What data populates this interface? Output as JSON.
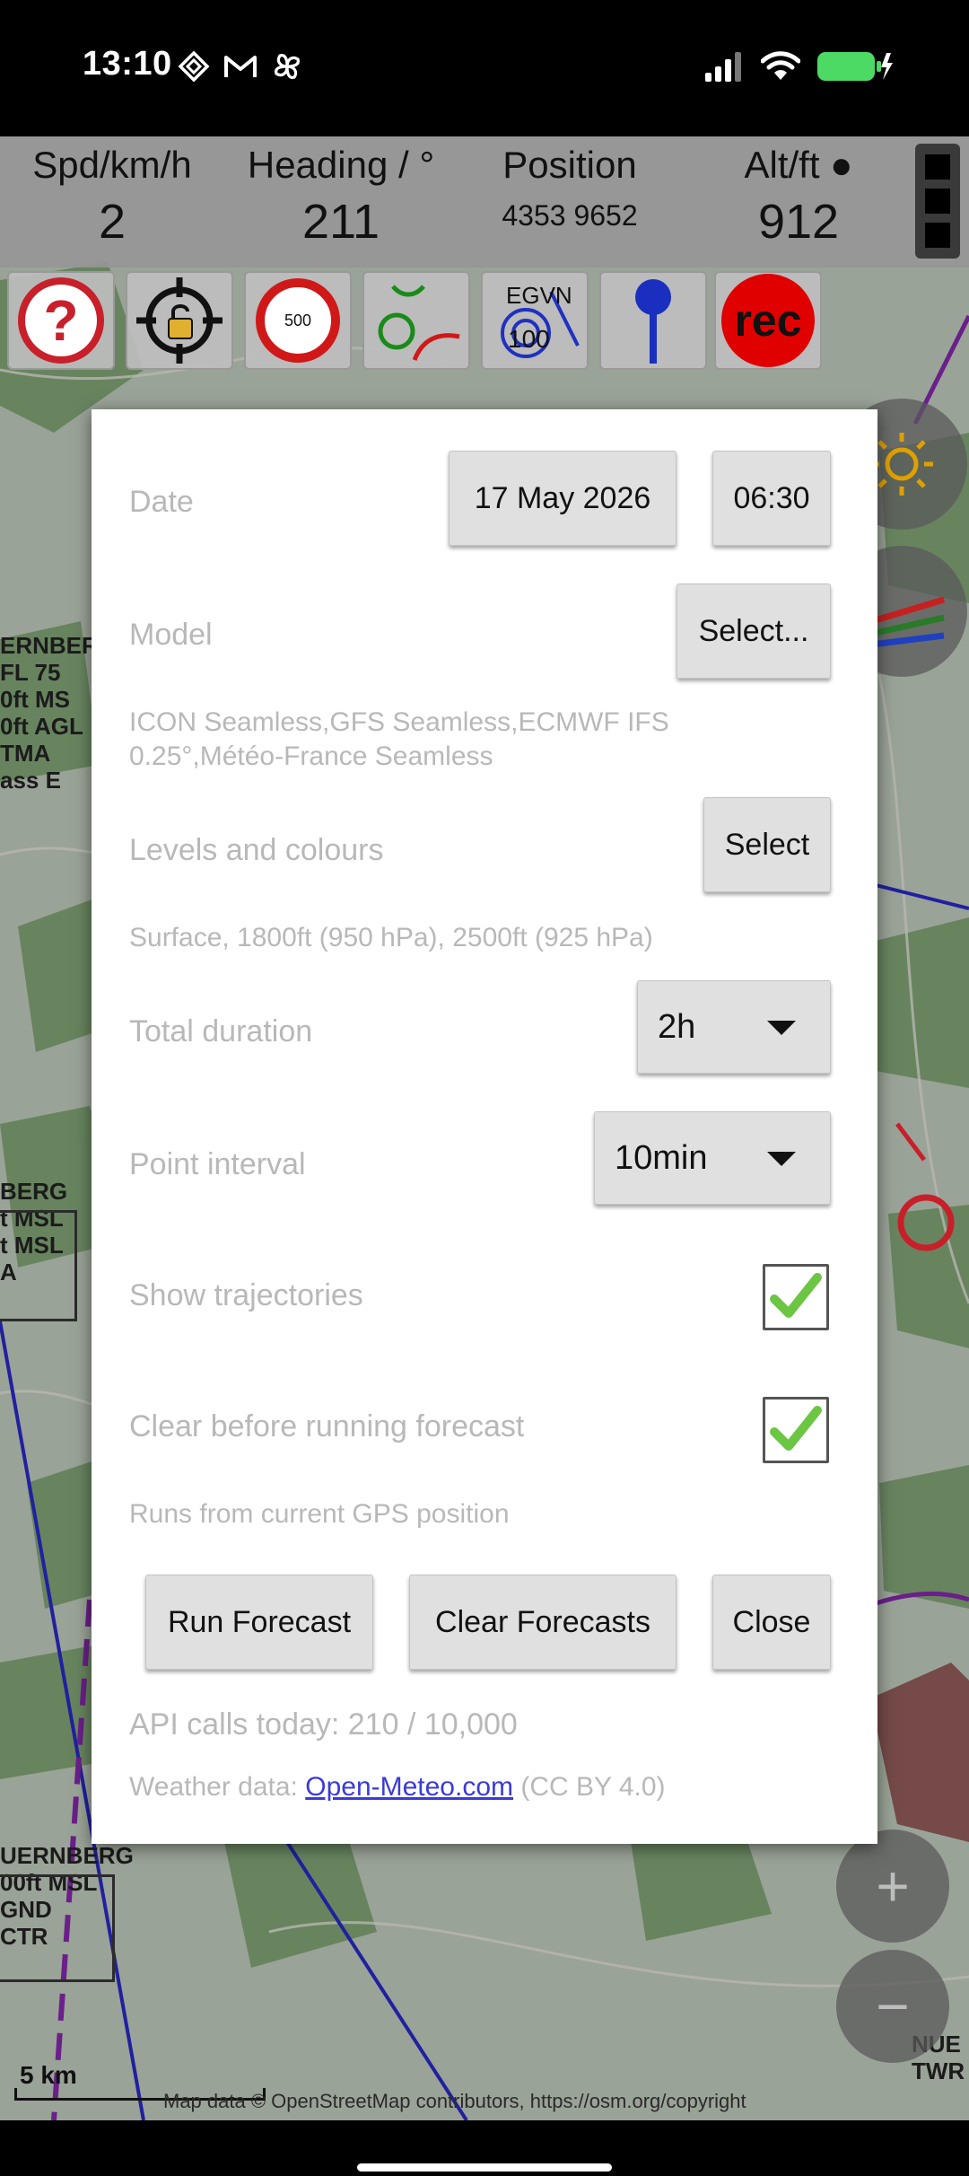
{
  "status_bar": {
    "time": "13:10",
    "left_icons": [
      "diamond-icon",
      "gmail-icon",
      "pinwheel-icon"
    ],
    "right_icons": [
      "signal-icon",
      "wifi-icon",
      "battery-charging-icon"
    ],
    "battery_color": "#4cd964"
  },
  "instruments": {
    "speed": {
      "label": "Spd/km/h",
      "value": "2"
    },
    "heading": {
      "label": "Heading / °",
      "value": "211"
    },
    "position": {
      "label": "Position",
      "value": "4353 9652"
    },
    "altitude": {
      "label": "Alt/ft ●",
      "value": "912"
    }
  },
  "toolbar": {
    "tools": [
      "help-icon",
      "lock-target-icon",
      "altitude-500-icon",
      "route-icon",
      "airport-egvn-icon",
      "pin-icon",
      "record-icon"
    ],
    "altitude_badge": "500",
    "airport_badge_top": "EGVN",
    "airport_badge_bottom": "100",
    "record_label": "rec"
  },
  "map": {
    "labels": {
      "nuernberg_top": "ERNBER\nFL 75\n0ft MS\n0ft AGL\nTMA\nass E",
      "nuernberg_mid": "BERG\nt MSL\nt MSL\nA",
      "nuernberg_bottom": "UERNBERG\n00ft MSL\nGND\nCTR",
      "nue_twr": "NUE\nTWR"
    },
    "scale": "5 km",
    "attribution": "Map data © OpenStreetMap contributors, https://osm.org/copyright",
    "zoom_in": "+",
    "zoom_out": "−"
  },
  "dialog": {
    "date_label": "Date",
    "date_value": "17 May 2026",
    "time_value": "06:30",
    "model_label": "Model",
    "model_button": "Select...",
    "model_summary_line1": "ICON Seamless,GFS Seamless,ECMWF IFS",
    "model_summary_line2": "0.25°,Météo-France Seamless",
    "levels_label": "Levels and colours",
    "levels_button": "Select",
    "levels_summary": "Surface, 1800ft (950 hPa), 2500ft (925 hPa)",
    "duration_label": "Total duration",
    "duration_value": "2h",
    "interval_label": "Point interval",
    "interval_value": "10min",
    "trajectories_label": "Show trajectories",
    "trajectories_checked": true,
    "clear_label": "Clear before running forecast",
    "clear_checked": true,
    "runs_from": "Runs from current GPS position",
    "run_button": "Run Forecast",
    "clear_button": "Clear Forecasts",
    "close_button": "Close",
    "api_calls": "API calls today: 210 / 10,000",
    "weather_prefix": "Weather data: ",
    "weather_link": "Open-Meteo.com",
    "weather_suffix": " (CC BY 4.0)",
    "check_color": "#6cc644"
  }
}
